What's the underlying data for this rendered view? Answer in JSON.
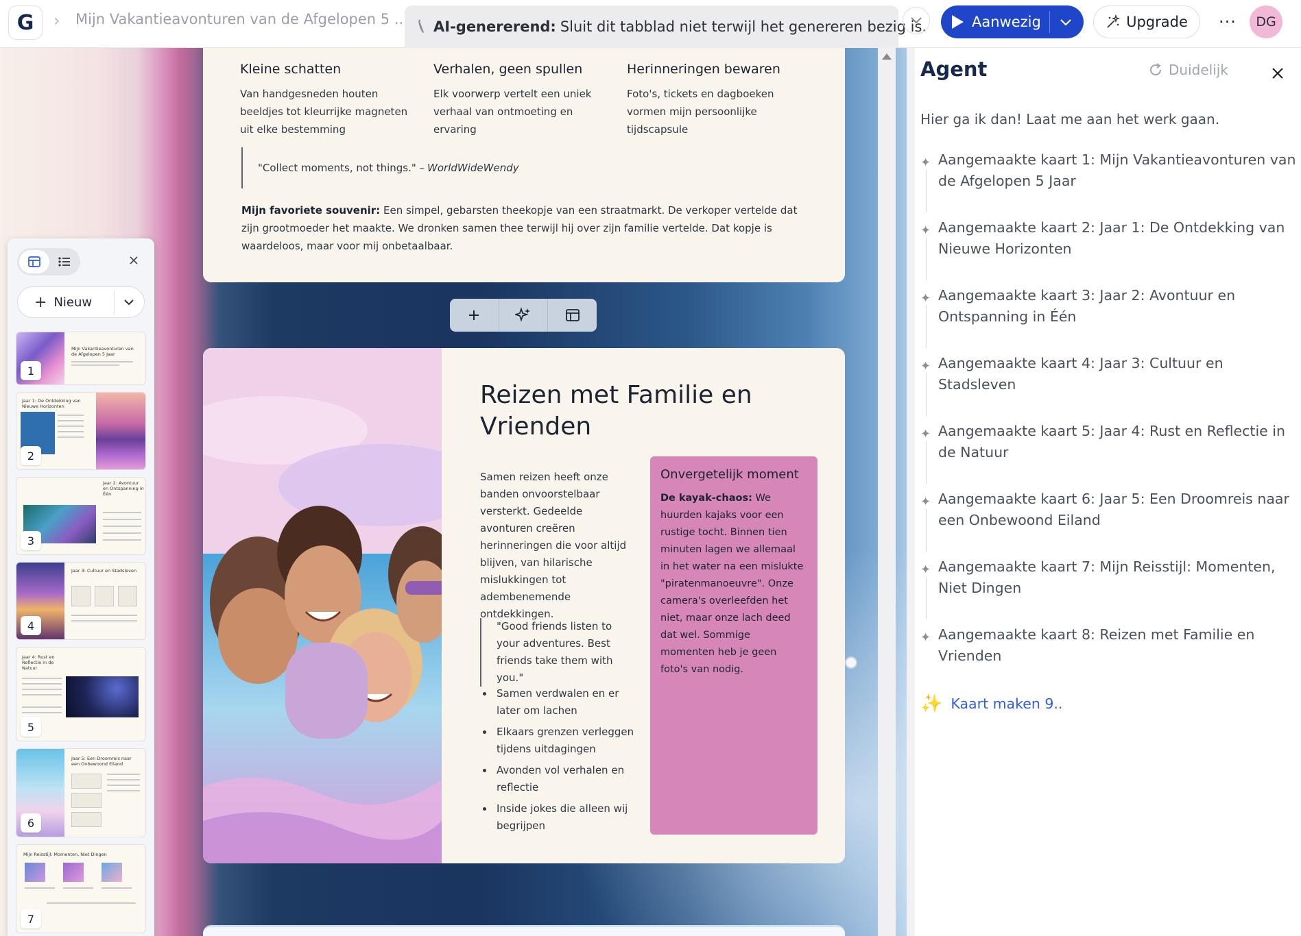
{
  "app": {
    "logo_letter": "G",
    "doc_title": "Mijn Vakantieavonturen van de Afgelopen 5 ...",
    "generating_bold": "AI-genererend:",
    "generating_text": "Sluit dit tabblad niet terwijl het genereren bezig is.",
    "present_label": "Aanwezig",
    "upgrade_label": "Upgrade",
    "more_label": "···",
    "avatar_initials": "DG",
    "accent_color": "#1f46c9"
  },
  "card7": {
    "columns": [
      {
        "title": "Kleine schatten",
        "text": "Van handgesneden houten beeldjes tot kleurrijke magneten uit elke bestemming"
      },
      {
        "title": "Verhalen, geen spullen",
        "text": "Elk voorwerp vertelt een uniek verhaal van ontmoeting en ervaring"
      },
      {
        "title": "Herinneringen bewaren",
        "text": "Foto's, tickets en dagboeken vormen mijn persoonlijke tijdscapsule"
      }
    ],
    "quote_text": "\"Collect moments, not things.\" –",
    "quote_author": "WorldWideWendy",
    "favorite_label": "Mijn favoriete souvenir:",
    "favorite_text": "Een simpel, gebarsten theekopje van een straatmarkt. De verkoper vertelde dat zijn grootmoeder het maakte. We dronken samen thee terwijl hij over zijn familie vertelde. Dat kopje is waardeloos, maar voor mij onbetaalbaar."
  },
  "card8": {
    "title": "Reizen met Familie en Vrienden",
    "body": "Samen reizen heeft onze banden onvoorstelbaar versterkt. Gedeelde avonturen creëren herinneringen die voor altijd blijven, van hilarische mislukkingen tot adembenemende ontdekkingen.",
    "quote": "\"Good friends listen to your adventures. Best friends take them with you.\"",
    "bullets": [
      "Samen verdwalen en er later om lachen",
      "Elkaars grenzen verleggen tijdens uitdagingen",
      "Avonden vol verhalen en reflectie",
      "Inside jokes die alleen wij begrijpen"
    ],
    "callout_title": "Onvergetelijk moment",
    "callout_bold": "De kayak-chaos:",
    "callout_text": "We huurden kajaks voor een rustige tocht. Binnen tien minuten lagen we allemaal in het water na een mislukte \"piratenmanoeuvre\". Onze camera's overleefden het niet, maar onze lach deed dat wel. Sommige momenten heb je geen foto's van nodig.",
    "callout_color": "#d686b8"
  },
  "slides": {
    "new_label": "Nieuw",
    "thumbs": [
      {
        "num": "1",
        "title": "Mijn Vakantieavonturen van de Afgelopen 5 Jaar"
      },
      {
        "num": "2",
        "title": "Jaar 1: De Ontdekking van Nieuwe Horizonten"
      },
      {
        "num": "3",
        "title": "Jaar 2: Avontuur en Ontspanning in Één"
      },
      {
        "num": "4",
        "title": "Jaar 3: Cultuur en Stadsleven"
      },
      {
        "num": "5",
        "title": "Jaar 4: Rust en Reflectie in de Natuur"
      },
      {
        "num": "6",
        "title": "Jaar 5: Een Droomreis naar een Onbewoond Eiland"
      },
      {
        "num": "7",
        "title": "Mijn Reisstijl: Momenten, Niet Dingen"
      }
    ]
  },
  "agent": {
    "title": "Agent",
    "clear_label": "Duidelijk",
    "intro": "Hier ga ik dan! Laat me aan het werk gaan.",
    "steps": [
      "Aangemaakte kaart 1: Mijn Vakantieavonturen van de Afgelopen 5 Jaar",
      "Aangemaakte kaart 2: Jaar 1: De Ontdekking van Nieuwe Horizonten",
      "Aangemaakte kaart 3: Jaar 2: Avontuur en Ontspanning in Één",
      "Aangemaakte kaart 4: Jaar 3: Cultuur en Stadsleven",
      "Aangemaakte kaart 5: Jaar 4: Rust en Reflectie in de Natuur",
      "Aangemaakte kaart 6: Jaar 5: Een Droomreis naar een Onbewoond Eiland",
      "Aangemaakte kaart 7: Mijn Reisstijl: Momenten, Niet Dingen",
      "Aangemaakte kaart 8: Reizen met Familie en Vrienden"
    ],
    "making_label": "Kaart maken 9.."
  }
}
